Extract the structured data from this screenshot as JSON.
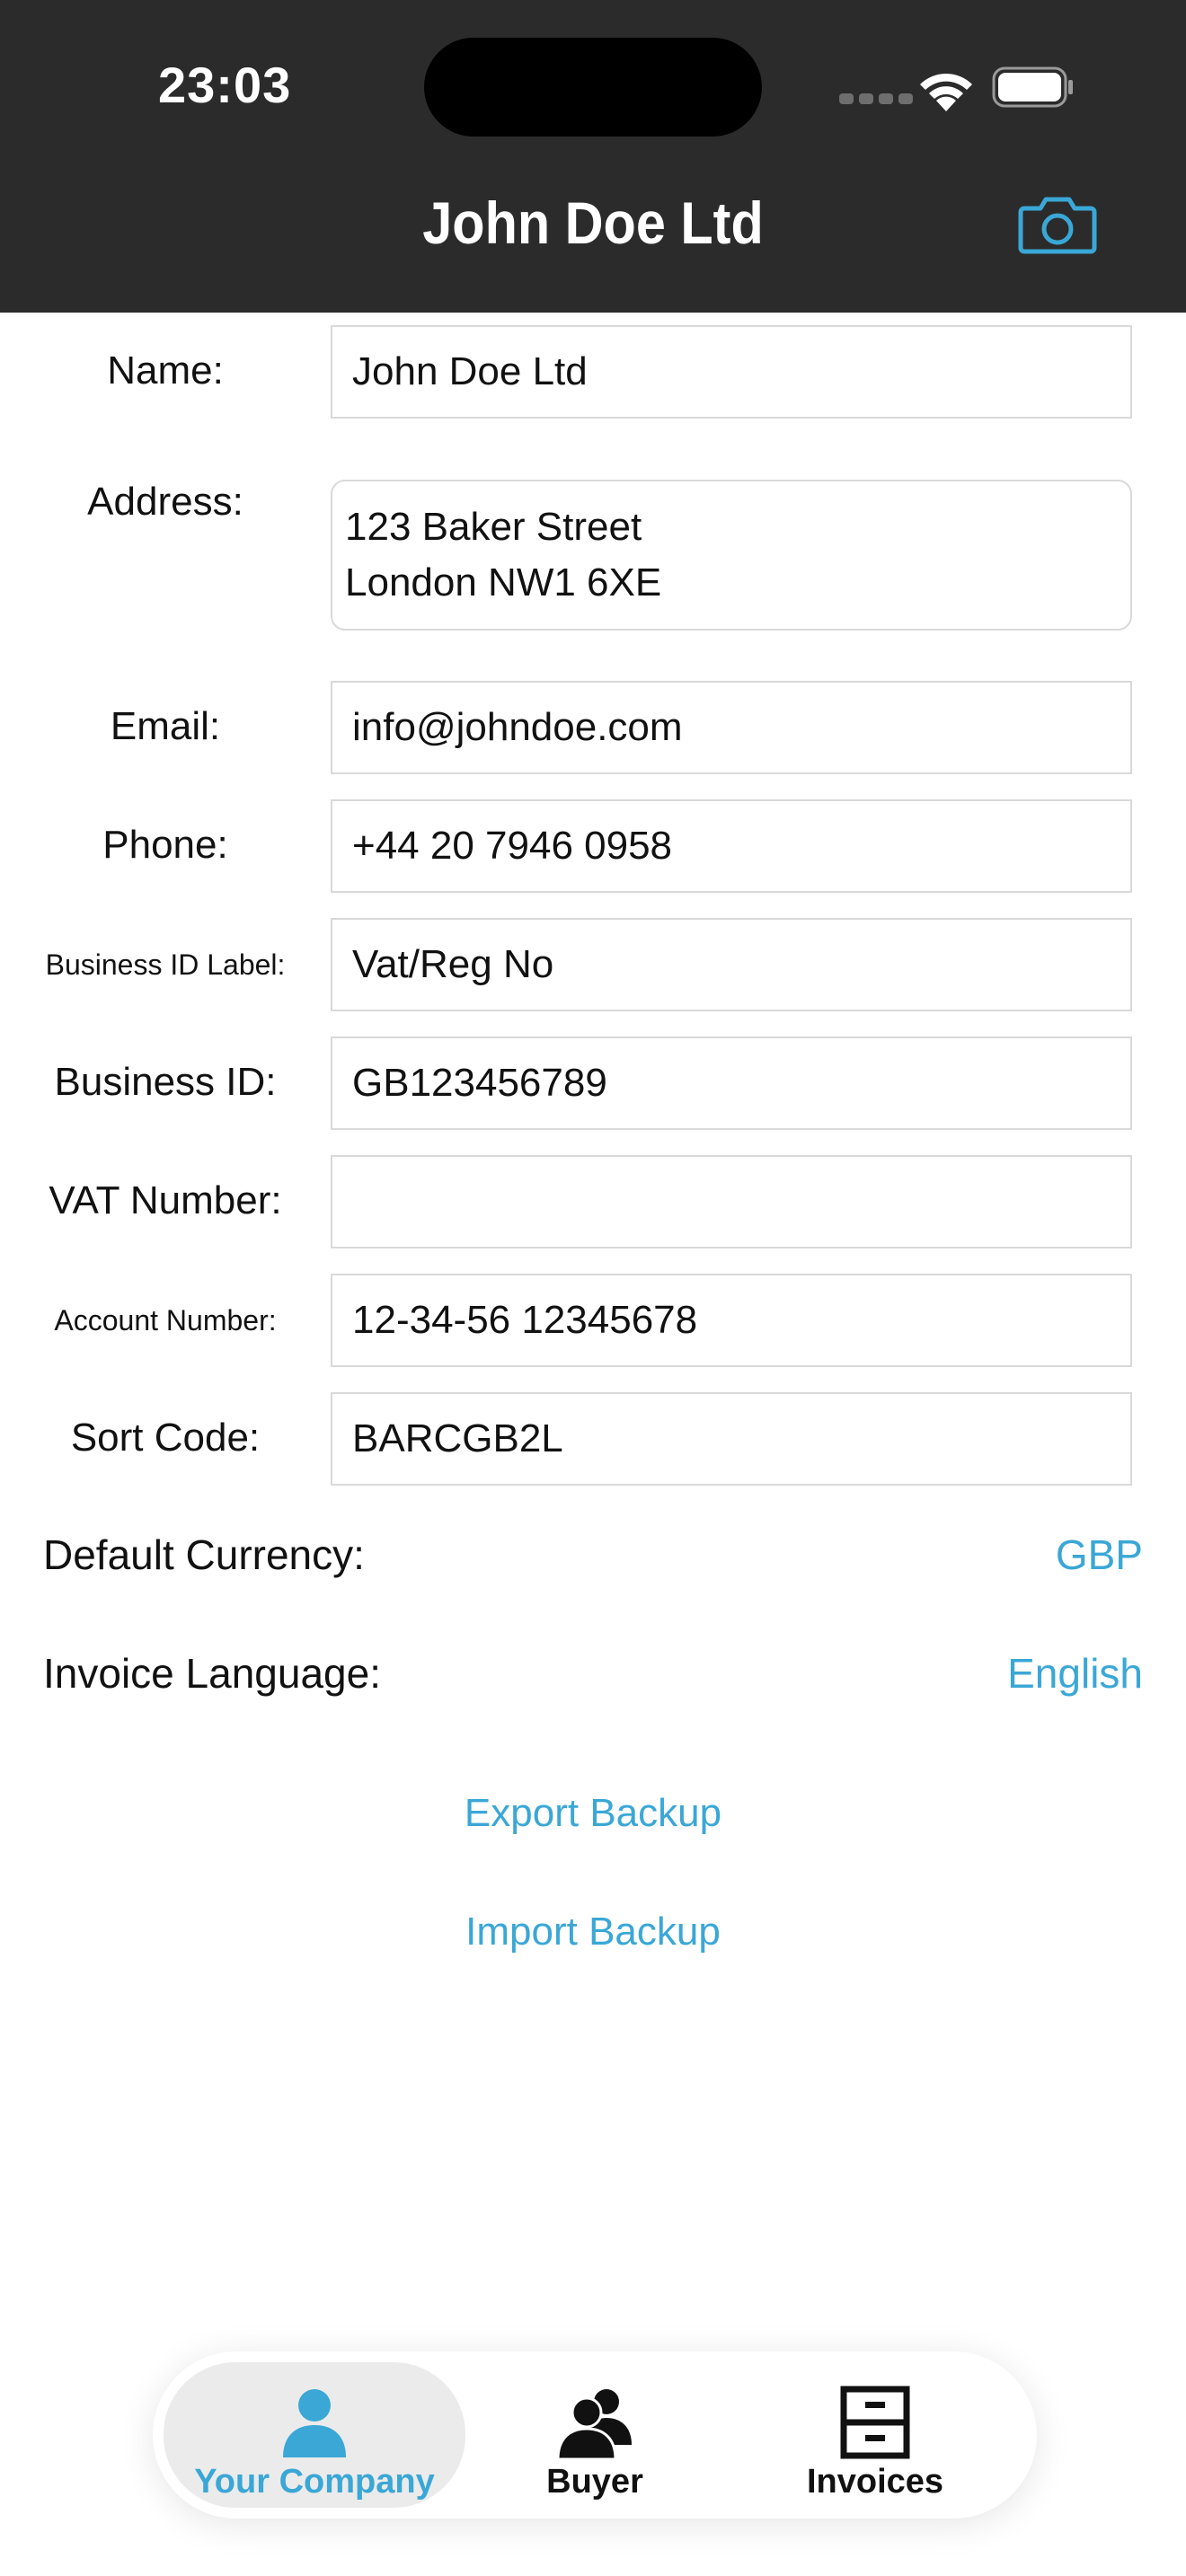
{
  "status": {
    "time": "23:03"
  },
  "header": {
    "title": "John Doe Ltd",
    "camera_icon": "camera-icon"
  },
  "form": {
    "name": {
      "label": "Name:",
      "value": "John Doe Ltd"
    },
    "address": {
      "label": "Address:",
      "line1": "123 Baker Street",
      "line2": "London NW1 6XE"
    },
    "email": {
      "label": "Email:",
      "value": "info@johndoe.com"
    },
    "phone": {
      "label": "Phone:",
      "value": "+44 20 7946 0958"
    },
    "business_id_label": {
      "label": "Business ID Label:",
      "value": "Vat/Reg No"
    },
    "business_id": {
      "label": "Business ID:",
      "value": "GB123456789"
    },
    "vat_number": {
      "label": "VAT Number:",
      "value": ""
    },
    "account_number": {
      "label": "Account Number:",
      "value": "12-34-56 12345678"
    },
    "sort_code": {
      "label": "Sort Code:",
      "value": "BARCGB2L"
    }
  },
  "preferences": {
    "currency": {
      "label": "Default Currency:",
      "value": "GBP"
    },
    "language": {
      "label": "Invoice Language:",
      "value": "English"
    }
  },
  "actions": {
    "export": "Export Backup",
    "import": "Import Backup"
  },
  "tabs": [
    {
      "label": "Your Company",
      "icon": "person-icon",
      "active": true
    },
    {
      "label": "Buyer",
      "icon": "people-icon",
      "active": false
    },
    {
      "label": "Invoices",
      "icon": "file-cabinet-icon",
      "active": false
    }
  ],
  "colors": {
    "accent": "#3aa7d6",
    "header_bg": "#2b2b2b"
  }
}
